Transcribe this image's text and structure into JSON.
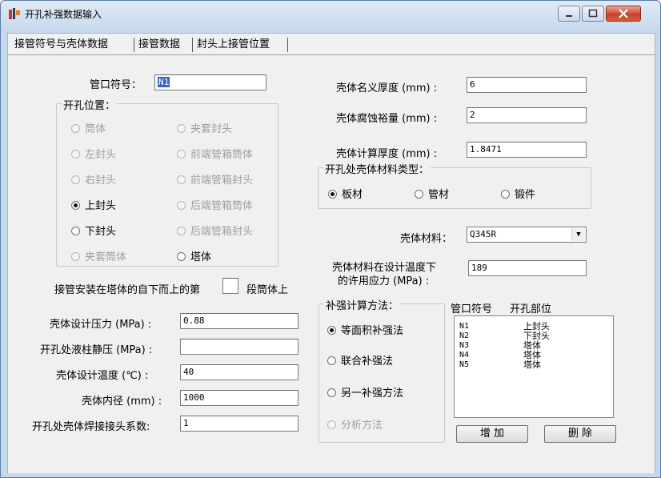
{
  "window": {
    "title": "开孔补强数据输入"
  },
  "tabs": [
    {
      "label": "接管符号与壳体数据"
    },
    {
      "label": "接管数据"
    },
    {
      "label": "封头上接管位置"
    }
  ],
  "left": {
    "nozzle_symbol_label": "管口符号：",
    "nozzle_symbol_value": "N1",
    "position_group_title": "开孔位置：",
    "positions": [
      "筒体",
      "夹套封头",
      "左封头",
      "前端管箱筒体",
      "右封头",
      "前端管箱封头",
      "上封头",
      "后端管箱筒体",
      "下封头",
      "后端管箱封头",
      "夹套筒体",
      "塔体"
    ],
    "tower_segment_label_a": "接管安装在塔体的自下而上的第",
    "tower_segment_label_b": "段筒体上",
    "tower_segment_value": "",
    "design_pressure_label": "壳体设计压力 (MPa) :",
    "design_pressure_value": "0.88",
    "liquid_pressure_label": "开孔处液柱静压 (MPa) :",
    "liquid_pressure_value": "",
    "design_temp_label": "壳体设计温度 (℃) :",
    "design_temp_value": "40",
    "inner_diameter_label": "壳体内径 (mm) :",
    "inner_diameter_value": "1000",
    "weld_factor_label": "开孔处壳体焊接接头系数:",
    "weld_factor_value": "1"
  },
  "right": {
    "nominal_thickness_label": "壳体名义厚度 (mm) :",
    "nominal_thickness_value": "6",
    "corrosion_label": "壳体腐蚀裕量 (mm) :",
    "corrosion_value": "2",
    "calc_thickness_label": "壳体计算厚度 (mm) :",
    "calc_thickness_value": "1.8471",
    "material_type_title": "开孔处壳体材料类型：",
    "material_types": [
      "板材",
      "管材",
      "锻件"
    ],
    "material_label": "壳体材料：",
    "material_value": "Q345R",
    "allowable_stress_label_a": "壳体材料在设计温度下",
    "allowable_stress_label_b": "的许用应力 (MPa) :",
    "allowable_stress_value": "189",
    "reinforce_title": "补强计算方法：",
    "reinforce_methods": [
      "等面积补强法",
      "联合补强法",
      "另一补强方法",
      "分析方法"
    ],
    "list_header_symbol": "管口符号",
    "list_header_part": "开孔部位",
    "nozzle_list": [
      {
        "symbol": "N1",
        "part": "上封头"
      },
      {
        "symbol": "N2",
        "part": "下封头"
      },
      {
        "symbol": "N3",
        "part": "塔体"
      },
      {
        "symbol": "N4",
        "part": "塔体"
      },
      {
        "symbol": "N5",
        "part": "塔体"
      }
    ],
    "add_button": "增 加",
    "delete_button": "删 除"
  }
}
